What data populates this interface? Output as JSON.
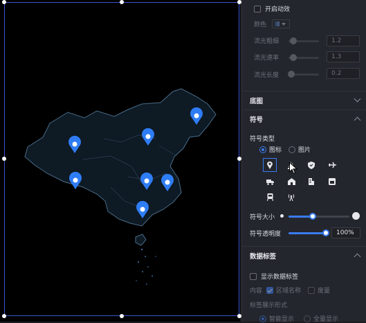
{
  "colors": {
    "accent": "#3a7cf0",
    "pin": "#2f7df6",
    "map_fill": "#0e1a24",
    "map_stroke": "#4a6d8a",
    "canvas": "#000000",
    "panel": "#24262d"
  },
  "map": {
    "pin_count": 7
  },
  "panel": {
    "animation": {
      "enable_label": "开启动效",
      "enabled": false
    },
    "color": {
      "label": "颜色"
    },
    "flow_width": {
      "label": "流光粗细",
      "value": "1.2"
    },
    "flow_speed": {
      "label": "流光速率",
      "value": "1.3"
    },
    "flow_length": {
      "label": "流光长度",
      "value": "0.2"
    },
    "basemap": {
      "title": "底图"
    },
    "symbol": {
      "title": "符号",
      "type_label": "符号类型",
      "type_options": [
        "图标",
        "图片"
      ],
      "type_selected": "图标",
      "icons": [
        "location-pin-icon",
        "sailboat-icon",
        "shield-check-icon",
        "airplane-icon",
        "truck-icon",
        "house-icon",
        "building-icon",
        "shop-icon",
        "train-icon",
        "antenna-icon"
      ],
      "size_label": "符号大小",
      "size_level": 0.38,
      "opacity_label": "符号透明度",
      "opacity_value": "100%",
      "opacity_level": 1.0
    },
    "data_label": {
      "title": "数据标签",
      "show_label": "显示数据标签",
      "show_enabled": false,
      "content_label": "内容",
      "content_options": [
        "区域名称",
        "度量"
      ],
      "content_checked": [
        "区域名称"
      ],
      "display_form_label": "标签展示形式",
      "display_options": [
        "智能显示",
        "全量显示"
      ]
    }
  }
}
